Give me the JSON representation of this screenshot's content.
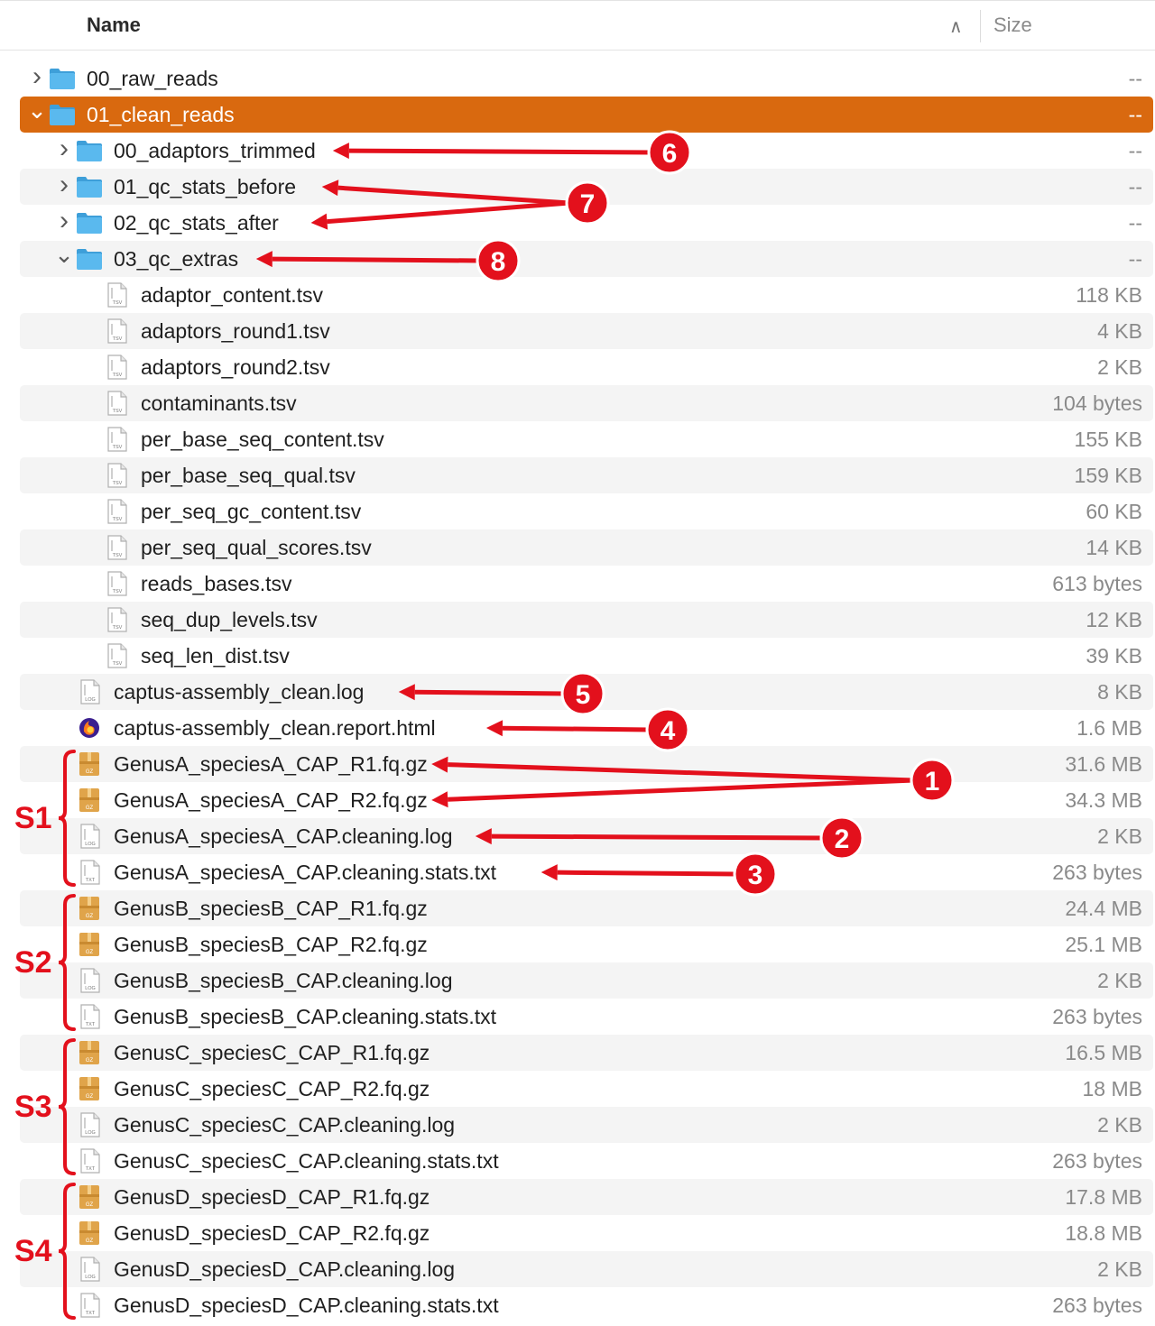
{
  "header": {
    "name_label": "Name",
    "size_label": "Size"
  },
  "rows": [
    {
      "name": "00_raw_reads",
      "size": "--",
      "kind": "folder",
      "depth": 0,
      "chevron": "right"
    },
    {
      "name": "01_clean_reads",
      "size": "--",
      "kind": "folder",
      "depth": 0,
      "chevron": "down",
      "selected": true
    },
    {
      "name": "00_adaptors_trimmed",
      "size": "--",
      "kind": "folder",
      "depth": 1,
      "chevron": "right"
    },
    {
      "name": "01_qc_stats_before",
      "size": "--",
      "kind": "folder",
      "depth": 1,
      "chevron": "right"
    },
    {
      "name": "02_qc_stats_after",
      "size": "--",
      "kind": "folder",
      "depth": 1,
      "chevron": "right"
    },
    {
      "name": "03_qc_extras",
      "size": "--",
      "kind": "folder",
      "depth": 1,
      "chevron": "down"
    },
    {
      "name": "adaptor_content.tsv",
      "size": "118 KB",
      "kind": "tsv",
      "depth": 2
    },
    {
      "name": "adaptors_round1.tsv",
      "size": "4 KB",
      "kind": "tsv",
      "depth": 2
    },
    {
      "name": "adaptors_round2.tsv",
      "size": "2 KB",
      "kind": "tsv",
      "depth": 2
    },
    {
      "name": "contaminants.tsv",
      "size": "104 bytes",
      "kind": "tsv",
      "depth": 2
    },
    {
      "name": "per_base_seq_content.tsv",
      "size": "155 KB",
      "kind": "tsv",
      "depth": 2
    },
    {
      "name": "per_base_seq_qual.tsv",
      "size": "159 KB",
      "kind": "tsv",
      "depth": 2
    },
    {
      "name": "per_seq_gc_content.tsv",
      "size": "60 KB",
      "kind": "tsv",
      "depth": 2
    },
    {
      "name": "per_seq_qual_scores.tsv",
      "size": "14 KB",
      "kind": "tsv",
      "depth": 2
    },
    {
      "name": "reads_bases.tsv",
      "size": "613 bytes",
      "kind": "tsv",
      "depth": 2
    },
    {
      "name": "seq_dup_levels.tsv",
      "size": "12 KB",
      "kind": "tsv",
      "depth": 2
    },
    {
      "name": "seq_len_dist.tsv",
      "size": "39 KB",
      "kind": "tsv",
      "depth": 2
    },
    {
      "name": "captus-assembly_clean.log",
      "size": "8 KB",
      "kind": "log",
      "depth": 1
    },
    {
      "name": "captus-assembly_clean.report.html",
      "size": "1.6 MB",
      "kind": "html",
      "depth": 1
    },
    {
      "name": "GenusA_speciesA_CAP_R1.fq.gz",
      "size": "31.6 MB",
      "kind": "gz",
      "depth": 1
    },
    {
      "name": "GenusA_speciesA_CAP_R2.fq.gz",
      "size": "34.3 MB",
      "kind": "gz",
      "depth": 1
    },
    {
      "name": "GenusA_speciesA_CAP.cleaning.log",
      "size": "2 KB",
      "kind": "log",
      "depth": 1
    },
    {
      "name": "GenusA_speciesA_CAP.cleaning.stats.txt",
      "size": "263 bytes",
      "kind": "txt",
      "depth": 1
    },
    {
      "name": "GenusB_speciesB_CAP_R1.fq.gz",
      "size": "24.4 MB",
      "kind": "gz",
      "depth": 1
    },
    {
      "name": "GenusB_speciesB_CAP_R2.fq.gz",
      "size": "25.1 MB",
      "kind": "gz",
      "depth": 1
    },
    {
      "name": "GenusB_speciesB_CAP.cleaning.log",
      "size": "2 KB",
      "kind": "log",
      "depth": 1
    },
    {
      "name": "GenusB_speciesB_CAP.cleaning.stats.txt",
      "size": "263 bytes",
      "kind": "txt",
      "depth": 1
    },
    {
      "name": "GenusC_speciesC_CAP_R1.fq.gz",
      "size": "16.5 MB",
      "kind": "gz",
      "depth": 1
    },
    {
      "name": "GenusC_speciesC_CAP_R2.fq.gz",
      "size": "18 MB",
      "kind": "gz",
      "depth": 1
    },
    {
      "name": "GenusC_speciesC_CAP.cleaning.log",
      "size": "2 KB",
      "kind": "log",
      "depth": 1
    },
    {
      "name": "GenusC_speciesC_CAP.cleaning.stats.txt",
      "size": "263 bytes",
      "kind": "txt",
      "depth": 1
    },
    {
      "name": "GenusD_speciesD_CAP_R1.fq.gz",
      "size": "17.8 MB",
      "kind": "gz",
      "depth": 1
    },
    {
      "name": "GenusD_speciesD_CAP_R2.fq.gz",
      "size": "18.8 MB",
      "kind": "gz",
      "depth": 1
    },
    {
      "name": "GenusD_speciesD_CAP.cleaning.log",
      "size": "2 KB",
      "kind": "log",
      "depth": 1
    },
    {
      "name": "GenusD_speciesD_CAP.cleaning.stats.txt",
      "size": "263 bytes",
      "kind": "txt",
      "depth": 1
    }
  ],
  "groups": [
    {
      "label": "S1",
      "first_row": 19,
      "last_row": 22
    },
    {
      "label": "S2",
      "first_row": 23,
      "last_row": 26
    },
    {
      "label": "S3",
      "first_row": 27,
      "last_row": 30
    },
    {
      "label": "S4",
      "first_row": 31,
      "last_row": 34
    }
  ],
  "annotations": [
    {
      "number": "6",
      "targets": [
        2
      ]
    },
    {
      "number": "7",
      "targets": [
        3,
        4
      ]
    },
    {
      "number": "8",
      "targets": [
        5
      ]
    },
    {
      "number": "5",
      "targets": [
        17
      ]
    },
    {
      "number": "4",
      "targets": [
        18
      ]
    },
    {
      "number": "1",
      "targets": [
        19,
        20
      ]
    },
    {
      "number": "2",
      "targets": [
        21
      ]
    },
    {
      "number": "3",
      "targets": [
        22
      ]
    }
  ],
  "colors": {
    "selection": "#d9690f",
    "annotation": "#e3101c",
    "folder": "#5ab9ee",
    "archive": "#e0a44a"
  }
}
